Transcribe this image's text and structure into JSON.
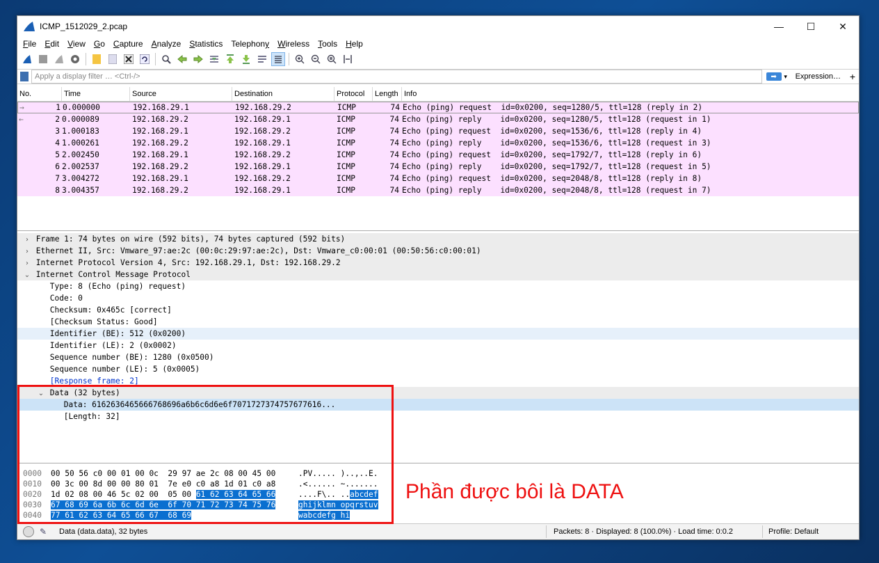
{
  "window": {
    "title": "ICMP_1512029_2.pcap",
    "controls": {
      "minimize": "—",
      "maximize": "☐",
      "close": "✕"
    }
  },
  "menu": [
    {
      "u": "F",
      "rest": "ile"
    },
    {
      "u": "E",
      "rest": "dit"
    },
    {
      "u": "V",
      "rest": "iew"
    },
    {
      "u": "G",
      "rest": "o"
    },
    {
      "u": "C",
      "rest": "apture"
    },
    {
      "u": "A",
      "rest": "nalyze"
    },
    {
      "u": "S",
      "rest": "tatistics"
    },
    {
      "pre": "Telephon",
      "u": "y",
      "rest": ""
    },
    {
      "u": "W",
      "rest": "ireless"
    },
    {
      "u": "T",
      "rest": "ools"
    },
    {
      "u": "H",
      "rest": "elp"
    }
  ],
  "filter": {
    "placeholder": "Apply a display filter … <Ctrl-/>",
    "expression": "Expression…",
    "plus": "+",
    "arrow": "➡",
    "drop": "▾"
  },
  "columns": {
    "no": "No.",
    "time": "Time",
    "source": "Source",
    "destination": "Destination",
    "protocol": "Protocol",
    "length": "Length",
    "info": "Info"
  },
  "packets": [
    {
      "no": "1",
      "time": "0.000000",
      "src": "192.168.29.1",
      "dst": "192.168.29.2",
      "proto": "ICMP",
      "len": "74",
      "info": "Echo (ping) request  id=0x0200, seq=1280/5, ttl=128 (reply in 2)",
      "arrow": "→"
    },
    {
      "no": "2",
      "time": "0.000089",
      "src": "192.168.29.2",
      "dst": "192.168.29.1",
      "proto": "ICMP",
      "len": "74",
      "info": "Echo (ping) reply    id=0x0200, seq=1280/5, ttl=128 (request in 1)",
      "arrow": "←"
    },
    {
      "no": "3",
      "time": "1.000183",
      "src": "192.168.29.1",
      "dst": "192.168.29.2",
      "proto": "ICMP",
      "len": "74",
      "info": "Echo (ping) request  id=0x0200, seq=1536/6, ttl=128 (reply in 4)",
      "arrow": ""
    },
    {
      "no": "4",
      "time": "1.000261",
      "src": "192.168.29.2",
      "dst": "192.168.29.1",
      "proto": "ICMP",
      "len": "74",
      "info": "Echo (ping) reply    id=0x0200, seq=1536/6, ttl=128 (request in 3)",
      "arrow": ""
    },
    {
      "no": "5",
      "time": "2.002450",
      "src": "192.168.29.1",
      "dst": "192.168.29.2",
      "proto": "ICMP",
      "len": "74",
      "info": "Echo (ping) request  id=0x0200, seq=1792/7, ttl=128 (reply in 6)",
      "arrow": ""
    },
    {
      "no": "6",
      "time": "2.002537",
      "src": "192.168.29.2",
      "dst": "192.168.29.1",
      "proto": "ICMP",
      "len": "74",
      "info": "Echo (ping) reply    id=0x0200, seq=1792/7, ttl=128 (request in 5)",
      "arrow": ""
    },
    {
      "no": "7",
      "time": "3.004272",
      "src": "192.168.29.1",
      "dst": "192.168.29.2",
      "proto": "ICMP",
      "len": "74",
      "info": "Echo (ping) request  id=0x0200, seq=2048/8, ttl=128 (reply in 8)",
      "arrow": ""
    },
    {
      "no": "8",
      "time": "3.004357",
      "src": "192.168.29.2",
      "dst": "192.168.29.1",
      "proto": "ICMP",
      "len": "74",
      "info": "Echo (ping) reply    id=0x0200, seq=2048/8, ttl=128 (request in 7)",
      "arrow": ""
    }
  ],
  "details": [
    {
      "indent": 0,
      "exp": "›",
      "text": "Frame 1: 74 bytes on wire (592 bits), 74 bytes captured (592 bits)",
      "style": "grey"
    },
    {
      "indent": 0,
      "exp": "›",
      "text": "Ethernet II, Src: Vmware_97:ae:2c (00:0c:29:97:ae:2c), Dst: Vmware_c0:00:01 (00:50:56:c0:00:01)",
      "style": "grey"
    },
    {
      "indent": 0,
      "exp": "›",
      "text": "Internet Protocol Version 4, Src: 192.168.29.1, Dst: 192.168.29.2",
      "style": "grey"
    },
    {
      "indent": 0,
      "exp": "⌄",
      "text": "Internet Control Message Protocol",
      "style": "grey"
    },
    {
      "indent": 1,
      "exp": "",
      "text": "Type: 8 (Echo (ping) request)",
      "style": ""
    },
    {
      "indent": 1,
      "exp": "",
      "text": "Code: 0",
      "style": ""
    },
    {
      "indent": 1,
      "exp": "",
      "text": "Checksum: 0x465c [correct]",
      "style": ""
    },
    {
      "indent": 1,
      "exp": "",
      "text": "[Checksum Status: Good]",
      "style": ""
    },
    {
      "indent": 1,
      "exp": "",
      "text": "Identifier (BE): 512 (0x0200)",
      "style": "lblue"
    },
    {
      "indent": 1,
      "exp": "",
      "text": "Identifier (LE): 2 (0x0002)",
      "style": ""
    },
    {
      "indent": 1,
      "exp": "",
      "text": "Sequence number (BE): 1280 (0x0500)",
      "style": ""
    },
    {
      "indent": 1,
      "exp": "",
      "text": "Sequence number (LE): 5 (0x0005)",
      "style": ""
    },
    {
      "indent": 1,
      "exp": "",
      "text": "[Response frame: 2]",
      "style": "link"
    },
    {
      "indent": 1,
      "exp": "⌄",
      "text": "Data (32 bytes)",
      "style": "grey"
    },
    {
      "indent": 2,
      "exp": "",
      "text": "Data: 6162636465666768696a6b6c6d6e6f7071727374757677616...",
      "style": "hi"
    },
    {
      "indent": 2,
      "exp": "",
      "text": "[Length: 32]",
      "style": ""
    }
  ],
  "hex": [
    {
      "off": "0000",
      "b1": "00 50 56 c0 00 01 00 0c  29 97 ae 2c 08 00 45 00",
      "b2": "",
      "a1": ".PV..... )..,..E.",
      "a2": ""
    },
    {
      "off": "0010",
      "b1": "00 3c 00 8d 00 00 80 01  7e e0 c0 a8 1d 01 c0 a8",
      "b2": "",
      "a1": ".<...... ~.......",
      "a2": ""
    },
    {
      "off": "0020",
      "b1": "1d 02 08 00 46 5c 02 00  05 00 ",
      "b2": "61 62 63 64 65 66",
      "a1": "....F\\.. ..",
      "a2": "abcdef"
    },
    {
      "off": "0030",
      "b1": "",
      "b2": "67 68 69 6a 6b 6c 6d 6e  6f 70 71 72 73 74 75 76",
      "a1": "",
      "a2": "ghijklmn opqrstuv"
    },
    {
      "off": "0040",
      "b1": "",
      "b2": "77 61 62 63 64 65 66 67  68 69",
      "a1": "",
      "a2": "wabcdefg hi"
    }
  ],
  "status": {
    "field": "Data (data.data), 32 bytes",
    "packets": "Packets: 8 · Displayed: 8 (100.0%) · Load time: 0:0.2",
    "profile": "Profile: Default"
  },
  "annotation": "Phần được bôi là DATA"
}
